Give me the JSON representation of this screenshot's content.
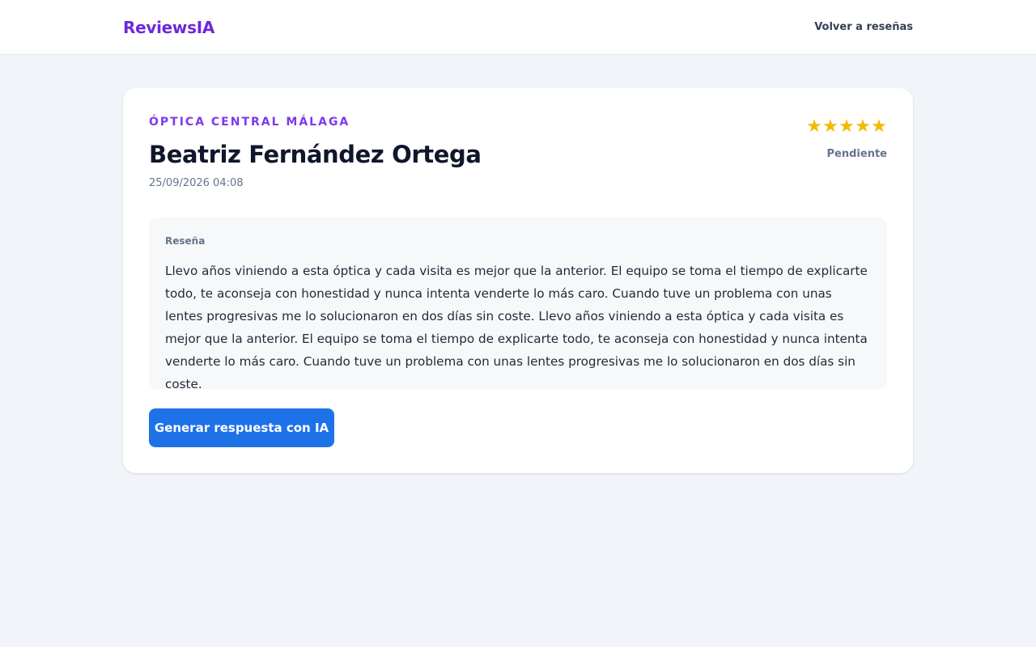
{
  "header": {
    "brand": "ReviewsIA",
    "back_link": "Volver a reseñas"
  },
  "review": {
    "business": "ÓPTICA CENTRAL MÁLAGA",
    "reviewer": "Beatriz Fernández Ortega",
    "date": "25/09/2026 04:08",
    "rating": 5,
    "stars": [
      "★",
      "★",
      "★",
      "★",
      "★"
    ],
    "status": "Pendiente",
    "section_label": "Reseña",
    "text": "Llevo años viniendo a esta óptica y cada visita es mejor que la anterior. El equipo se toma el tiempo de explicarte todo, te aconseja con honestidad y nunca intenta venderte lo más caro. Cuando tuve un problema con unas lentes progresivas me lo solucionaron en dos días sin coste. Llevo años viniendo a esta óptica y cada visita es mejor que la anterior. El equipo se toma el tiempo de explicarte todo, te aconseja con honestidad y nunca intenta venderte lo más caro. Cuando tuve un problema con unas lentes progresivas me lo solucionaron en dos días sin coste."
  },
  "actions": {
    "generate_label": "Generar respuesta con IA"
  },
  "colors": {
    "brand": "#6d28d9",
    "accent": "#1d72e8",
    "star": "#f5b800",
    "background": "#f1f4f8"
  }
}
